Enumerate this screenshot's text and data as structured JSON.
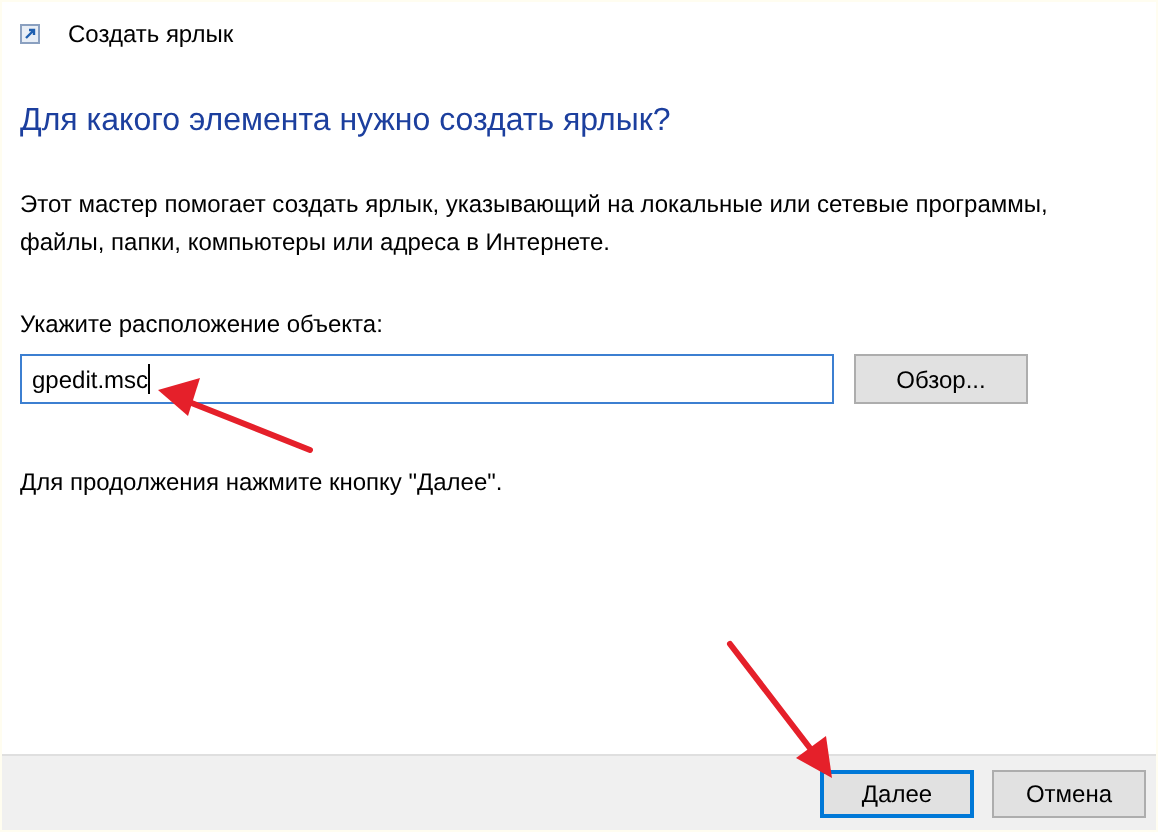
{
  "window": {
    "title": "Создать ярлык"
  },
  "heading": "Для какого элемента нужно создать ярлык?",
  "description": "Этот мастер помогает создать ярлык, указывающий на локальные или сетевые программы, файлы, папки, компьютеры или адреса в Интернете.",
  "location": {
    "label": "Укажите расположение объекта:",
    "value": "gpedit.msc",
    "browse_button": "Обзор..."
  },
  "hint": "Для продолжения нажмите кнопку \"Далее\".",
  "buttons": [
    {
      "label": "Далее",
      "focused": true
    },
    {
      "label": "Отмена",
      "focused": false
    }
  ]
}
